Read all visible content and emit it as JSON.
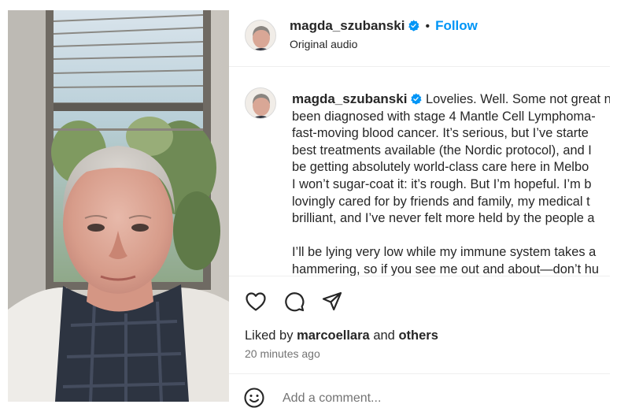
{
  "header": {
    "username": "magda_szubanski",
    "verified_icon": "verified-badge-icon",
    "separator": "•",
    "follow_label": "Follow",
    "audio_label": "Original audio",
    "accent_color": "#0095f6"
  },
  "caption": {
    "username": "magda_szubanski",
    "paragraphs": [
      [
        "Lovelies. Well. Some not great n",
        "been diagnosed with stage 4 Mantle Cell Lymphoma-",
        "fast-moving blood cancer. It’s serious, but I’ve starte",
        "best treatments available (the Nordic protocol), and I",
        "be getting absolutely world-class care here in Melbo",
        "I won’t sugar-coat it: it’s rough. But I’m hopeful. I’m b",
        "lovingly cared for by friends and family, my medical t",
        "brilliant, and I’ve never felt more held by the people a"
      ],
      [
        "I’ll be lying very low while my immune system takes a",
        "hammering, so if you see me out and about—don’t hu"
      ]
    ]
  },
  "actions": {
    "like_icon": "heart-icon",
    "comment_icon": "comment-icon",
    "share_icon": "send-icon"
  },
  "likes": {
    "prefix": "Liked by",
    "user": "marcoellara",
    "joiner": "and",
    "others": "others"
  },
  "timestamp": "20 minutes ago",
  "comment": {
    "emoji_icon": "emoji-icon",
    "placeholder": "Add a comment..."
  }
}
